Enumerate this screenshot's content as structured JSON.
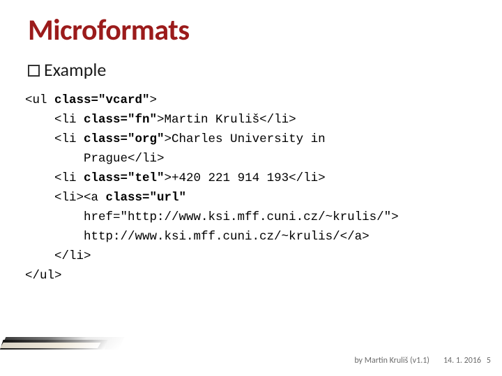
{
  "title": "Microformats",
  "subheading": "Example",
  "code_lines": [
    {
      "pre": "<ul ",
      "bold": "class=\"vcard\"",
      "post": ">"
    },
    {
      "pre": "    <li ",
      "bold": "class=\"fn\"",
      "post": ">Martin Kruliš</li>"
    },
    {
      "pre": "    <li ",
      "bold": "class=\"org\"",
      "post": ">Charles University in"
    },
    {
      "pre": "",
      "bold": "",
      "post": "        Prague</li>"
    },
    {
      "pre": "    <li ",
      "bold": "class=\"tel\"",
      "post": ">+420 221 914 193</li>"
    },
    {
      "pre": "    <li><a ",
      "bold": "class=\"url\"",
      "post": ""
    },
    {
      "pre": "",
      "bold": "",
      "post": "        href=\"http://www.ksi.mff.cuni.cz/~krulis/\">"
    },
    {
      "pre": "",
      "bold": "",
      "post": "        http://www.ksi.mff.cuni.cz/~krulis/</a>"
    },
    {
      "pre": "",
      "bold": "",
      "post": "    </li>"
    },
    {
      "pre": "",
      "bold": "",
      "post": "</ul>"
    }
  ],
  "footer": {
    "author": "by Martin Kruliš (v1.1)",
    "date": "14. 1. 2016",
    "page": "5"
  }
}
